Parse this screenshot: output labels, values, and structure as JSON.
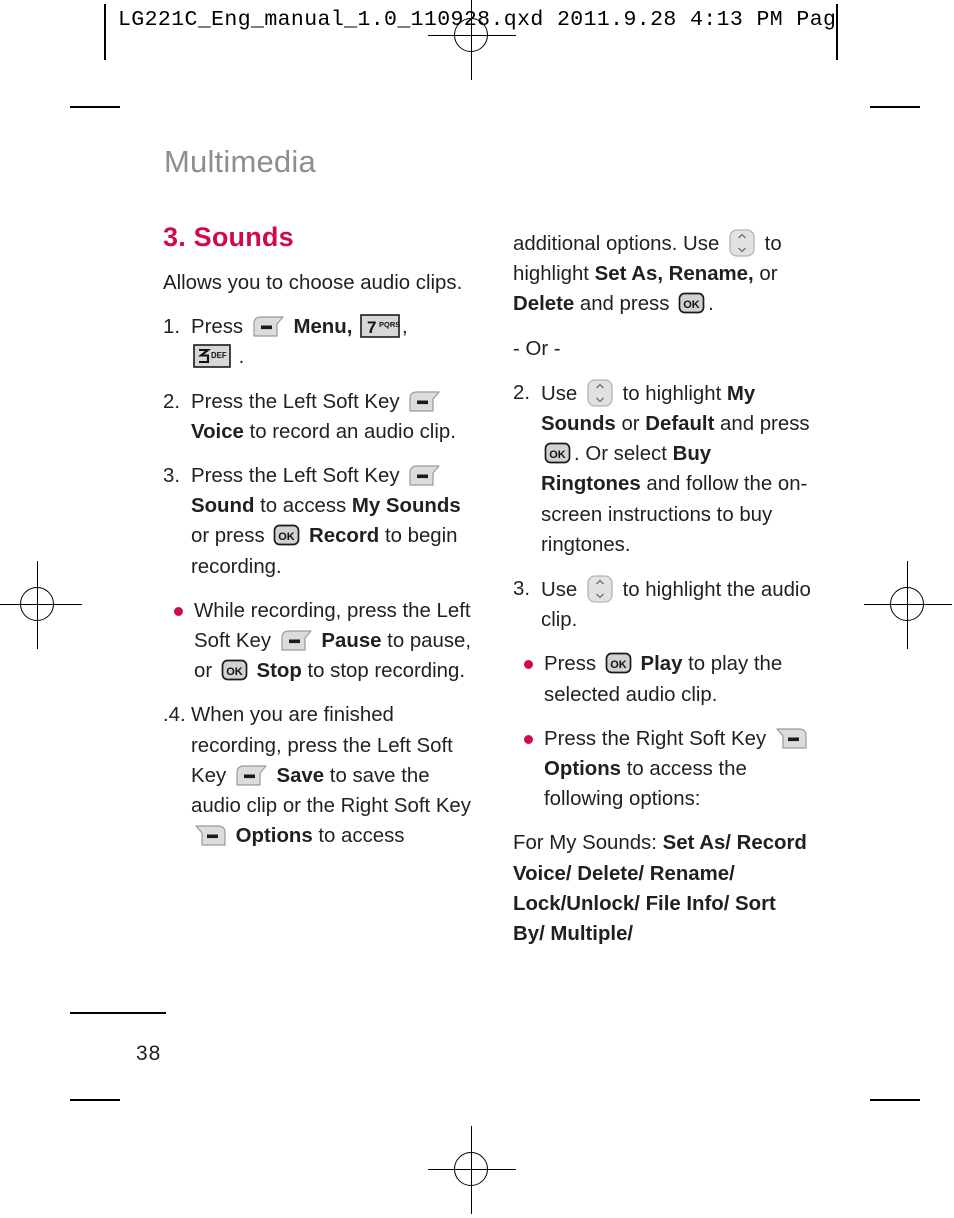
{
  "prepress": {
    "header_text": "LG221C_Eng_manual_1.0_110928.qxd   2011.9.28   4:13 PM   Pag"
  },
  "page": {
    "chapter_title": "Multimedia",
    "section_title": "3. Sounds",
    "page_number": "38"
  },
  "icons": {
    "left_soft_key": "left-soft-key-icon",
    "right_soft_key": "right-soft-key-icon",
    "ok_key": "ok-key-icon",
    "nav_key": "up-down-navigation-key-icon",
    "key_7": "number-key-7-pqrs-icon",
    "key_3": "number-key-3-def-icon",
    "ok_label": "OK",
    "key_7_digit": "7",
    "key_7_letters": "PQRS",
    "key_3_digit": "3",
    "key_3_letters": "DEF",
    "nav_up": "^",
    "nav_down": "v"
  },
  "left_column": {
    "intro": "Allows you to choose audio clips.",
    "step1": {
      "number": "1.",
      "text_a": "Press",
      "bold_menu": "Menu,",
      "text_b": "."
    },
    "step2": {
      "number": "2.",
      "text_a": "Press the Left Soft Key",
      "bold_a": "Voice",
      "text_b": "to record an audio clip."
    },
    "step3": {
      "number": "3.",
      "text_a": "Press the Left Soft Key",
      "bold_a": "Sound",
      "text_b": "to access",
      "bold_b": "My Sounds",
      "text_c": "or press",
      "bold_c": "Record",
      "text_d": "to begin recording."
    },
    "bullet1": {
      "text_a": "While recording, press the Left Soft Key",
      "bold_a": "Pause",
      "text_b": "to pause, or",
      "bold_b": "Stop",
      "text_c": "to stop recording."
    },
    "step4": {
      "number": ".4.",
      "text_a": "When you are finished recording, press the Left Soft Key",
      "bold_a": "Save",
      "text_b": "to save the audio clip or the Right Soft Key",
      "bold_b": "Options",
      "text_c": "to access"
    }
  },
  "right_column": {
    "continuation": {
      "text_a": "additional options. Use",
      "text_b": "to highlight",
      "bold_a": "Set As, Rename,",
      "text_c": "or",
      "bold_b": "Delete",
      "text_d": "and press",
      "text_e": "."
    },
    "or_separator": "- Or -",
    "step2": {
      "number": "2.",
      "text_a": "Use",
      "text_b": "to highlight",
      "bold_a": "My Sounds",
      "text_c": "or",
      "bold_b": "Default",
      "text_d": "and press",
      "text_e": ". Or select",
      "bold_c": "Buy Ringtones",
      "text_f": "and follow the on-screen instructions to buy ringtones."
    },
    "step3": {
      "number": "3.",
      "text_a": "Use",
      "text_b": "to highlight the audio clip."
    },
    "bullet1": {
      "text_a": "Press",
      "bold_a": "Play",
      "text_b": "to play the selected audio clip."
    },
    "bullet2": {
      "text_a": "Press the Right Soft Key",
      "bold_a": "Options",
      "text_b": "to access the following options:"
    },
    "options_list": {
      "label": "For My Sounds:",
      "options": "Set As/ Record Voice/ Delete/ Rename/ Lock/Unlock/ File Info/ Sort By/ Multiple/"
    }
  },
  "colors": {
    "accent": "#cf0a4b",
    "chapter_gray": "#8e8e8e",
    "body_text": "#231f20"
  }
}
